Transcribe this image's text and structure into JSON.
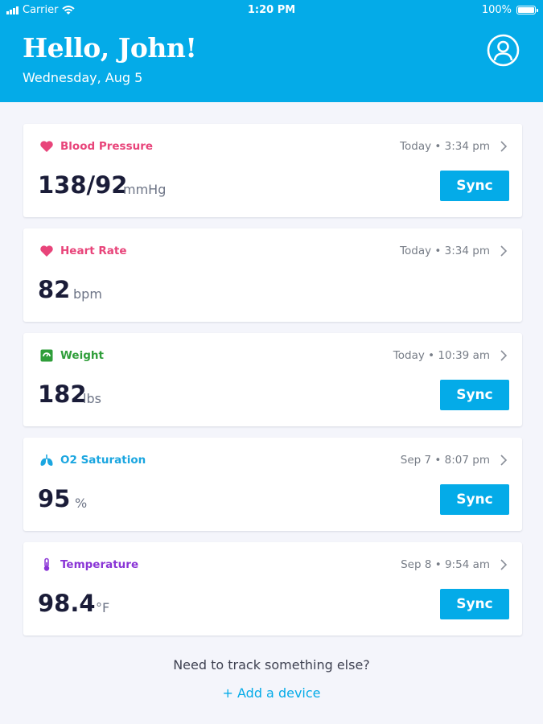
{
  "status": {
    "carrier": "Carrier",
    "time": "1:20 PM",
    "battery": "100%"
  },
  "header": {
    "greeting": "Hello, John!",
    "date": "Wednesday, Aug 5"
  },
  "cards": [
    {
      "title": "Blood Pressure",
      "time": "Today • 3:34 pm",
      "value": "138/92",
      "unit": "mmHg",
      "sync": "Sync",
      "icon": "heart-icon",
      "color": "#e8447a"
    },
    {
      "title": "Heart Rate",
      "time": "Today • 3:34 pm",
      "value": "82",
      "unit": "bpm",
      "icon": "heart-icon",
      "color": "#e8447a"
    },
    {
      "title": "Weight",
      "time": "Today • 10:39 am",
      "value": "182",
      "unit": "lbs",
      "sync": "Sync",
      "icon": "scale-icon",
      "color": "#2f9e3a"
    },
    {
      "title": "O2 Saturation",
      "time": "Sep 7 • 8:07 pm",
      "value": "95",
      "unit": "%",
      "sync": "Sync",
      "icon": "lungs-icon",
      "color": "#1ba6e0"
    },
    {
      "title": "Temperature",
      "time": "Sep 8 • 9:54 am",
      "value": "98.4",
      "unit": "°F",
      "sync": "Sync",
      "icon": "thermometer-icon",
      "color": "#8a35d6"
    }
  ],
  "footer": {
    "prompt": "Need to track something else?",
    "add_device": "+ Add a device"
  },
  "colors": {
    "accent": "#04abe8",
    "background": "#f4f5fb"
  }
}
